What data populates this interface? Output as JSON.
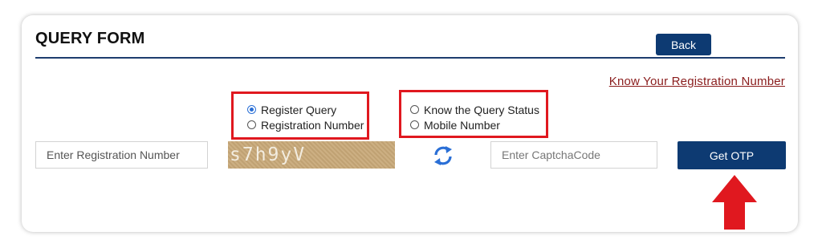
{
  "form": {
    "title": "QUERY FORM",
    "back_label": "Back",
    "know_reg_link": "Know Your Registration Number"
  },
  "query_type": {
    "options": [
      {
        "label": "Register Query",
        "selected": true
      },
      {
        "label": "Registration Number",
        "selected": false
      }
    ]
  },
  "status_type": {
    "options": [
      {
        "label": "Know the Query Status",
        "selected": false
      },
      {
        "label": "Mobile Number",
        "selected": false
      }
    ]
  },
  "registration_input": {
    "placeholder": "Enter Registration Number",
    "value": ""
  },
  "captcha": {
    "text": "s7h9yV"
  },
  "captcha_input": {
    "placeholder": "Enter CaptchaCode",
    "value": ""
  },
  "otp_button": {
    "label": "Get OTP"
  },
  "icons": {
    "refresh": "refresh-icon",
    "annotation": "red-up-arrow-icon"
  },
  "colors": {
    "primary": "#0d3a72",
    "link": "#8a1c1c",
    "highlight": "#e0181f",
    "radio_checked": "#2a6fd6",
    "captcha_bg": "#c8a878"
  }
}
